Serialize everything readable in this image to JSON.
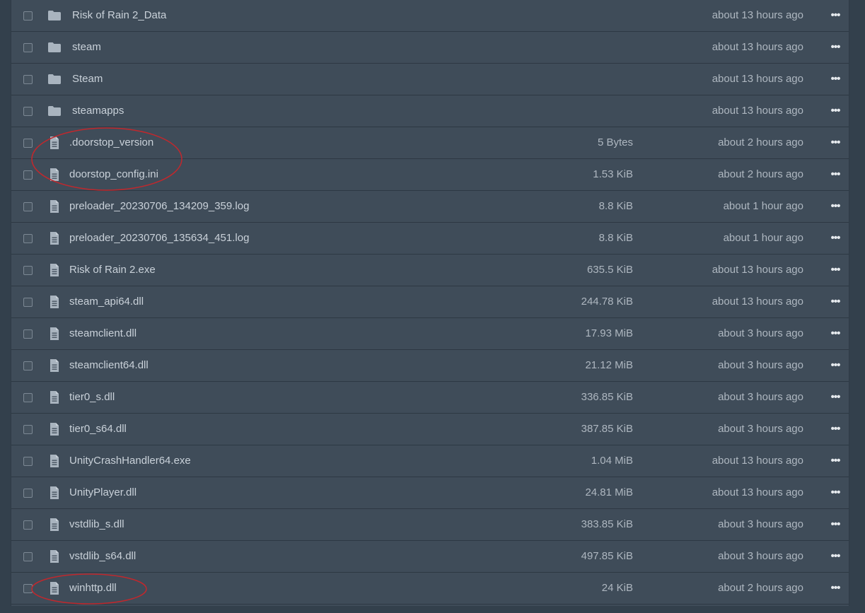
{
  "files": [
    {
      "type": "folder",
      "name": "Risk of Rain 2_Data",
      "size": "",
      "modified": "about 13 hours ago"
    },
    {
      "type": "folder",
      "name": "steam",
      "size": "",
      "modified": "about 13 hours ago"
    },
    {
      "type": "folder",
      "name": "Steam",
      "size": "",
      "modified": "about 13 hours ago"
    },
    {
      "type": "folder",
      "name": "steamapps",
      "size": "",
      "modified": "about 13 hours ago"
    },
    {
      "type": "file",
      "name": ".doorstop_version",
      "size": "5 Bytes",
      "modified": "about 2 hours ago"
    },
    {
      "type": "file",
      "name": "doorstop_config.ini",
      "size": "1.53 KiB",
      "modified": "about 2 hours ago"
    },
    {
      "type": "file",
      "name": "preloader_20230706_134209_359.log",
      "size": "8.8 KiB",
      "modified": "about 1 hour ago"
    },
    {
      "type": "file",
      "name": "preloader_20230706_135634_451.log",
      "size": "8.8 KiB",
      "modified": "about 1 hour ago"
    },
    {
      "type": "file",
      "name": "Risk of Rain 2.exe",
      "size": "635.5 KiB",
      "modified": "about 13 hours ago"
    },
    {
      "type": "file",
      "name": "steam_api64.dll",
      "size": "244.78 KiB",
      "modified": "about 13 hours ago"
    },
    {
      "type": "file",
      "name": "steamclient.dll",
      "size": "17.93 MiB",
      "modified": "about 3 hours ago"
    },
    {
      "type": "file",
      "name": "steamclient64.dll",
      "size": "21.12 MiB",
      "modified": "about 3 hours ago"
    },
    {
      "type": "file",
      "name": "tier0_s.dll",
      "size": "336.85 KiB",
      "modified": "about 3 hours ago"
    },
    {
      "type": "file",
      "name": "tier0_s64.dll",
      "size": "387.85 KiB",
      "modified": "about 3 hours ago"
    },
    {
      "type": "file",
      "name": "UnityCrashHandler64.exe",
      "size": "1.04 MiB",
      "modified": "about 13 hours ago"
    },
    {
      "type": "file",
      "name": "UnityPlayer.dll",
      "size": "24.81 MiB",
      "modified": "about 13 hours ago"
    },
    {
      "type": "file",
      "name": "vstdlib_s.dll",
      "size": "383.85 KiB",
      "modified": "about 3 hours ago"
    },
    {
      "type": "file",
      "name": "vstdlib_s64.dll",
      "size": "497.85 KiB",
      "modified": "about 3 hours ago"
    },
    {
      "type": "file",
      "name": "winhttp.dll",
      "size": "24 KiB",
      "modified": "about 2 hours ago"
    }
  ],
  "more_glyph": "•••",
  "icons": {
    "folder": "folder-icon",
    "file": "file-icon",
    "more": "more-options-icon"
  },
  "colors": {
    "annotation": "#c0282d",
    "row_bg": "#3f4c59",
    "text": "#c9d1d9"
  }
}
